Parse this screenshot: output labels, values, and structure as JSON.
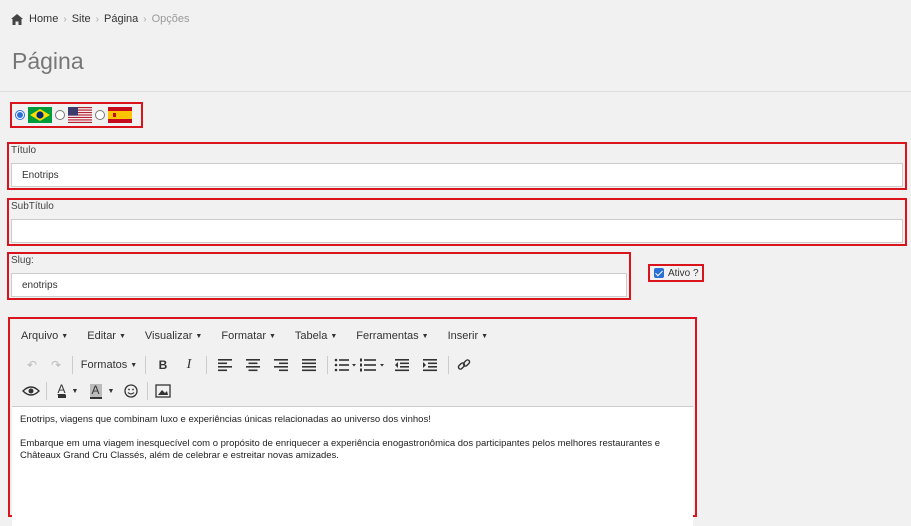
{
  "breadcrumb": {
    "home": "Home",
    "site": "Site",
    "pagina": "Página",
    "opcoes": "Opções"
  },
  "page_title": "Página",
  "languages": [
    {
      "flag": "brazil-flag-icon",
      "selected": true
    },
    {
      "flag": "usa-flag-icon",
      "selected": false
    },
    {
      "flag": "spain-flag-icon",
      "selected": false
    }
  ],
  "titulo": {
    "label": "Título",
    "value": "Enotrips"
  },
  "subtitulo": {
    "label": "SubTítulo",
    "value": ""
  },
  "slug": {
    "label": "Slug:",
    "value": "enotrips"
  },
  "ativo": {
    "label": "Ativo ?",
    "checked": true
  },
  "editor": {
    "menus": [
      "Arquivo",
      "Editar",
      "Visualizar",
      "Formatar",
      "Tabela",
      "Ferramentas",
      "Inserir"
    ],
    "formatos": "Formatos",
    "paragraphs": [
      "Enotrips, viagens que combinam luxo e experiências únicas relacionadas ao universo dos vinhos!",
      "Embarque em uma viagem inesquecível com o propósito de enriquecer a experiência enogastronômica dos participantes pelos melhores restaurantes e Châteaux Grand Cru Classés, além de celebrar e estreitar novas amizades."
    ]
  },
  "colors": {
    "highlight_border": "#d9141d",
    "accent": "#2a6ed8"
  }
}
